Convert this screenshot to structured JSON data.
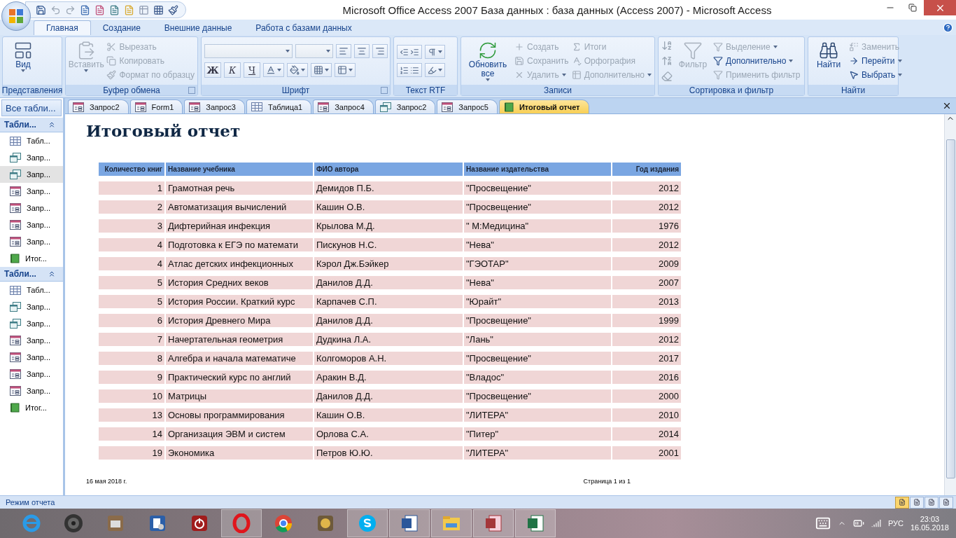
{
  "window": {
    "title": "Microsoft Office Access 2007 База данных : база данных (Access 2007) - Microsoft Access"
  },
  "ribbon": {
    "tabs": [
      {
        "label": "Главная",
        "selected": true
      },
      {
        "label": "Создание",
        "selected": false
      },
      {
        "label": "Внешние данные",
        "selected": false
      },
      {
        "label": "Работа с базами данных",
        "selected": false
      }
    ],
    "groups": [
      {
        "kind": "view",
        "label": "Представления",
        "launcher": false,
        "items": [
          {
            "kind": "large",
            "label": "Вид",
            "disabled": false,
            "dropdown": true
          }
        ]
      },
      {
        "kind": "clipboard",
        "label": "Буфер обмена",
        "launcher": true,
        "items": [
          {
            "kind": "large",
            "label": "Вставить",
            "disabled": true,
            "dropdown": true
          },
          {
            "kind": "small",
            "label": "Вырезать",
            "disabled": true,
            "dropdown": false
          },
          {
            "kind": "small",
            "label": "Копировать",
            "disabled": true,
            "dropdown": false
          },
          {
            "kind": "small",
            "label": "Формат по образцу",
            "disabled": true,
            "dropdown": false
          }
        ]
      },
      {
        "kind": "font",
        "label": "Шрифт",
        "launcher": true,
        "items": [
          {
            "kind": "bold",
            "label": "Ж",
            "disabled": false
          },
          {
            "kind": "italic",
            "label": "К",
            "disabled": false
          },
          {
            "kind": "underline",
            "label": "Ч",
            "disabled": false
          }
        ]
      },
      {
        "kind": "rtf",
        "label": "Текст RTF",
        "launcher": false
      },
      {
        "kind": "records",
        "label": "Записи",
        "launcher": false,
        "items": [
          {
            "kind": "large",
            "label": "Обновить все",
            "disabled": false,
            "dropdown": true
          },
          {
            "kind": "small",
            "label": "Создать",
            "disabled": true,
            "dropdown": false
          },
          {
            "kind": "small",
            "label": "Сохранить",
            "disabled": true,
            "dropdown": false
          },
          {
            "kind": "small",
            "label": "Удалить",
            "disabled": true,
            "dropdown": true
          },
          {
            "kind": "small",
            "label": "Итоги",
            "disabled": true,
            "dropdown": false
          },
          {
            "kind": "small",
            "label": "Орфография",
            "disabled": true,
            "dropdown": false
          },
          {
            "kind": "small",
            "label": "Дополнительно",
            "disabled": true,
            "dropdown": true
          }
        ]
      },
      {
        "kind": "sort",
        "label": "Сортировка и фильтр",
        "launcher": false,
        "items": [
          {
            "kind": "large",
            "label": "Фильтр",
            "disabled": true,
            "dropdown": false
          },
          {
            "kind": "small",
            "label": "Выделение",
            "disabled": true,
            "dropdown": true
          },
          {
            "kind": "small",
            "label": "Дополнительно",
            "disabled": false,
            "dropdown": true
          },
          {
            "kind": "small",
            "label": "Применить фильтр",
            "disabled": true,
            "dropdown": false
          }
        ]
      },
      {
        "kind": "find",
        "label": "Найти",
        "launcher": false,
        "items": [
          {
            "kind": "large",
            "label": "Найти",
            "disabled": false,
            "dropdown": false
          },
          {
            "kind": "small",
            "label": "Заменить",
            "disabled": true,
            "dropdown": false
          },
          {
            "kind": "small",
            "label": "Перейти",
            "disabled": false,
            "dropdown": true
          },
          {
            "kind": "small",
            "label": "Выбрать",
            "disabled": false,
            "dropdown": true
          }
        ]
      }
    ]
  },
  "nav_pane": {
    "header": "Все табли...",
    "groups": [
      {
        "title": "Табли...",
        "expanded": true,
        "items": [
          {
            "kind": "table",
            "label": "Табл...",
            "selected": false
          },
          {
            "kind": "query",
            "label": "Запр...",
            "selected": false
          },
          {
            "kind": "query",
            "label": "Запр...",
            "selected": true
          },
          {
            "kind": "form",
            "label": "Запр...",
            "selected": false
          },
          {
            "kind": "form",
            "label": "Запр...",
            "selected": false
          },
          {
            "kind": "form",
            "label": "Запр...",
            "selected": false
          },
          {
            "kind": "form",
            "label": "Запр...",
            "selected": false
          },
          {
            "kind": "report",
            "label": "Итог...",
            "selected": false
          }
        ]
      },
      {
        "title": "Табли...",
        "expanded": true,
        "items": [
          {
            "kind": "table",
            "label": "Табл...",
            "selected": false
          },
          {
            "kind": "query",
            "label": "Запр...",
            "selected": false
          },
          {
            "kind": "query",
            "label": "Запр...",
            "selected": false
          },
          {
            "kind": "form",
            "label": "Запр...",
            "selected": false
          },
          {
            "kind": "form",
            "label": "Запр...",
            "selected": false
          },
          {
            "kind": "form",
            "label": "Запр...",
            "selected": false
          },
          {
            "kind": "form",
            "label": "Запр...",
            "selected": false
          },
          {
            "kind": "report",
            "label": "Итог...",
            "selected": false
          }
        ]
      }
    ]
  },
  "doc_tabs": [
    {
      "kind": "form",
      "label": "Запрос2",
      "selected": false
    },
    {
      "kind": "form",
      "label": "Form1",
      "selected": false
    },
    {
      "kind": "form",
      "label": "Запрос3",
      "selected": false
    },
    {
      "kind": "table",
      "label": "Таблица1",
      "selected": false
    },
    {
      "kind": "form",
      "label": "Запрос4",
      "selected": false
    },
    {
      "kind": "query",
      "label": "Запрос2",
      "selected": false
    },
    {
      "kind": "form",
      "label": "Запрос5",
      "selected": false
    },
    {
      "kind": "report",
      "label": "Итоговый отчет",
      "selected": true
    }
  ],
  "report": {
    "title": "Итоговый отчет",
    "columns": [
      "Количество книг",
      "Название учебника",
      "ФИО автора",
      "Название издательства",
      "Год издания"
    ],
    "rows": [
      [
        "1",
        "Грамотная речь",
        "Демидов П.Б.",
        "\"Просвещение\"",
        "2012"
      ],
      [
        "2",
        "Автоматизация вычислений",
        "Кашин О.В.",
        "\"Просвещение\"",
        "2012"
      ],
      [
        "3",
        "Дифтерийная инфекция",
        "Крылова М.Д.",
        "\" М:Медицина\"",
        "1976"
      ],
      [
        "4",
        "Подготовка к ЕГЭ по математи",
        "Пискунов Н.С.",
        "\"Нева\"",
        "2012"
      ],
      [
        "4",
        "Атлас детских инфекционных",
        "Кэрол Дж.Бэйкер",
        "\"ГЭОТАР\"",
        "2009"
      ],
      [
        "5",
        "История Средних веков",
        "Данилов Д.Д.",
        "\"Нева\"",
        "2007"
      ],
      [
        "5",
        "История России. Краткий курс",
        "Карпачев С.П.",
        "\"Юрайт\"",
        "2013"
      ],
      [
        "6",
        "История Древнего Мира",
        "Данилов Д.Д.",
        "\"Просвещение\"",
        "1999"
      ],
      [
        "7",
        "Начертательная геометрия",
        "Дудкина Л.А.",
        "\"Лань\"",
        "2012"
      ],
      [
        "8",
        "Алгебра и начала математиче",
        "Колгоморов А.Н.",
        "\"Просвещение\"",
        "2017"
      ],
      [
        "9",
        "Практический курс по англий",
        "Аракин В.Д.",
        "\"Владос\"",
        "2016"
      ],
      [
        "10",
        "Матрицы",
        "Данилов Д.Д.",
        "\"Просвещение\"",
        "2000"
      ],
      [
        "13",
        "Основы программирования",
        "Кашин О.В.",
        "\"ЛИТЕРА\"",
        "2010"
      ],
      [
        "14",
        "Организация ЭВМ и систем",
        "Орлова С.А.",
        "\"Питер\"",
        "2014"
      ],
      [
        "19",
        "Экономика",
        "Петров Ю.Ю.",
        "\"ЛИТЕРА\"",
        "2001"
      ]
    ],
    "footer_date": "16 мая 2018 г.",
    "footer_page": "Страница 1 из 1"
  },
  "status_bar": {
    "text": "Режим отчета",
    "views": [
      {
        "selected": true
      },
      {
        "selected": false
      },
      {
        "selected": false
      },
      {
        "selected": false
      }
    ]
  },
  "taskbar": {
    "apps": [
      {
        "kind": "ie",
        "active": false
      },
      {
        "kind": "speaker",
        "active": false
      },
      {
        "kind": "doc",
        "active": false
      },
      {
        "kind": "settings",
        "active": false
      },
      {
        "kind": "power",
        "active": false
      },
      {
        "kind": "opera",
        "active": true
      },
      {
        "kind": "chrome",
        "active": false
      },
      {
        "kind": "disk",
        "active": false
      },
      {
        "kind": "skype",
        "active": true
      },
      {
        "kind": "word",
        "active": true
      },
      {
        "kind": "explorer",
        "active": true
      },
      {
        "kind": "access",
        "active": true
      },
      {
        "kind": "excel",
        "active": true
      }
    ],
    "language": "РУС",
    "time": "23:03",
    "date": "16.05.2018"
  }
}
